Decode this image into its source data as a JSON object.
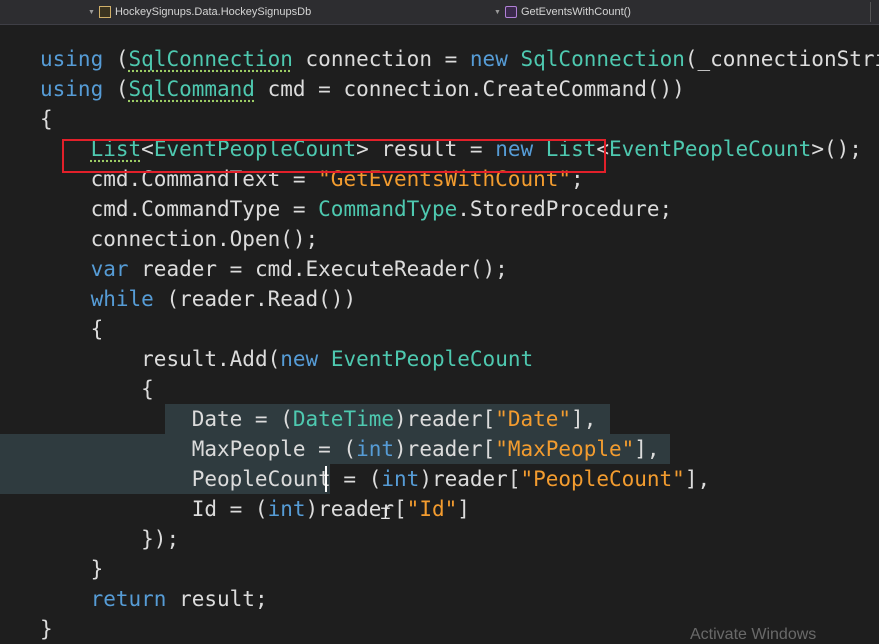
{
  "nav_bar": {
    "class_dropdown": "HockeySignups.Data.HockeySignupsDb",
    "member_dropdown": "GetEventsWithCount()"
  },
  "code": {
    "l1": {
      "kw": "using",
      "p1": " (",
      "type": "SqlConnection",
      "p2": " connection = ",
      "kw2": "new",
      "p3": " ",
      "type2": "SqlConnection",
      "p4": "(_connectionString"
    },
    "l2": {
      "kw": "using",
      "p1": " (",
      "type": "SqlCommand",
      "p2": " cmd = connection.CreateCommand())"
    },
    "l3": {
      "text": "{"
    },
    "l4": {
      "i": "    ",
      "type": "List",
      "p1": "<",
      "type2": "EventPeopleCount",
      "p2": "> result = ",
      "kw": "new",
      "p3": " ",
      "type3": "List",
      "p4": "<",
      "type4": "EventPeopleCount",
      "p5": ">();"
    },
    "l5": {
      "i": "    ",
      "p1": "cmd.CommandText = ",
      "str": "\"GetEventsWithCount\"",
      "p2": ";"
    },
    "l6": {
      "i": "    ",
      "p1": "cmd.CommandType = ",
      "type": "CommandType",
      "p2": ".StoredProcedure;"
    },
    "l7": {
      "i": "    ",
      "p1": "connection.Open();"
    },
    "l8": {
      "i": "    ",
      "kw": "var",
      "p1": " reader = cmd.ExecuteReader();"
    },
    "l9": {
      "i": "    ",
      "kw": "while",
      "p1": " (reader.Read())"
    },
    "l10": {
      "i": "    ",
      "p1": "{"
    },
    "l11": {
      "i": "        ",
      "p1": "result.Add(",
      "kw": "new",
      "p2": " ",
      "type": "EventPeopleCount"
    },
    "l12": {
      "i": "        ",
      "p1": "{"
    },
    "l13": {
      "i": "            ",
      "p1": "Date = (",
      "type": "DateTime",
      "p2": ")reader[",
      "str": "\"Date\"",
      "p3": "],"
    },
    "l14": {
      "i": "            ",
      "p1": "MaxPeople = (",
      "kw": "int",
      "p2": ")reader[",
      "str": "\"MaxPeople\"",
      "p3": "],"
    },
    "l15": {
      "i": "            ",
      "p1": "PeopleCount = (",
      "kw": "int",
      "p2": ")reader[",
      "str": "\"PeopleCount\"",
      "p3": "],"
    },
    "l16": {
      "i": "            ",
      "p1": "Id = (",
      "kw": "int",
      "p2": ")reader[",
      "str": "\"Id\"",
      "p3": "]"
    },
    "l17": {
      "i": "        ",
      "p1": "});"
    },
    "l18": {
      "i": "    ",
      "p1": "}"
    },
    "l19": {
      "i": "    ",
      "kw": "return",
      "p1": " result;"
    },
    "l20": {
      "text": "}"
    }
  },
  "watermark": "Activate Windows",
  "colors": {
    "keyword": "#569cd6",
    "type": "#4ec9b0",
    "string": "#d69d85",
    "changed_string": "#f39c2f",
    "background": "#1e1e1e",
    "highlight": "#2f3b3f",
    "box": "#e2202a"
  }
}
